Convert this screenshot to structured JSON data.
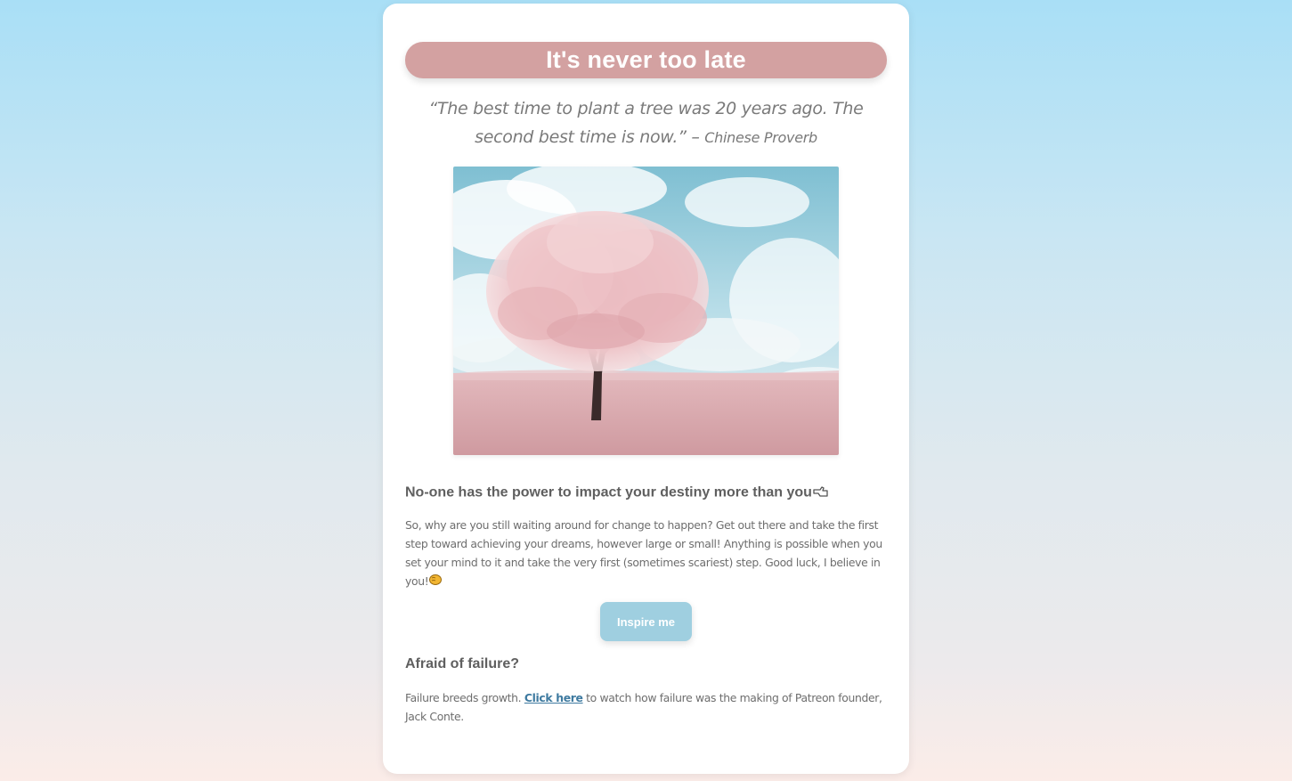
{
  "card": {
    "title": "It's never too late",
    "quote": {
      "text": "“The best time to plant a tree was 20 years ago. The second best time is now.” –",
      "attribution": "Chinese Proverb"
    },
    "hero_image": {
      "icon": "pink-tree-photo"
    },
    "section_one": {
      "heading": "No-one has the power to impact your destiny more than you",
      "heading_icon": "pointing-hand-icon",
      "body": "So, why are you still waiting around for change to happen? Get out there and take the first step toward achieving your dreams, however large or small! Anything is possible when you set your mind to it and take the very first (sometimes scariest) step. Good luck, I believe in you!",
      "body_icon": "fist-bump-icon"
    },
    "inspire_button": {
      "label": "Inspire me"
    },
    "section_two": {
      "heading": "Afraid of failure?",
      "body_before": "Failure breeds growth.",
      "link_text": "Click here",
      "body_after": "to watch how failure was the making of Patreon founder, Jack Conte."
    }
  },
  "colors": {
    "title_pill": "#d3a1a1",
    "button": "#9fcfe0",
    "link": "#3e7aa0",
    "background_top": "#a9dff6",
    "background_bottom": "#fbece8"
  }
}
